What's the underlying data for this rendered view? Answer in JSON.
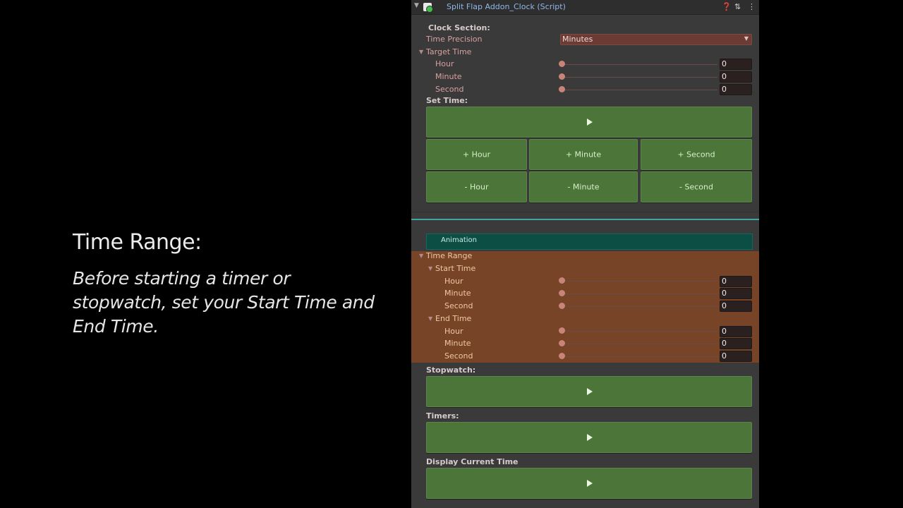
{
  "caption": {
    "title": "Time Range:",
    "body": "Before starting a timer or stopwatch, set your Start Time and End Time."
  },
  "inspector": {
    "title": "Split Flap Addon_Clock (Script)",
    "icons": [
      "help-icon",
      "preset-icon",
      "more-icon"
    ],
    "clock_section_label": "Clock Section:",
    "time_precision": {
      "label": "Time Precision",
      "value": "Minutes"
    },
    "target_time": {
      "label": "Target Time",
      "fields": [
        {
          "label": "Hour",
          "value": "0"
        },
        {
          "label": "Minute",
          "value": "0"
        },
        {
          "label": "Second",
          "value": "0"
        }
      ]
    },
    "set_time": {
      "label": "Set Time:",
      "buttons_plus": [
        "+ Hour",
        "+ Minute",
        "+ Second"
      ],
      "buttons_minus": [
        "- Hour",
        "- Minute",
        "- Second"
      ]
    },
    "animation_label": "Animation",
    "time_range": {
      "label": "Time Range",
      "start": {
        "label": "Start Time",
        "fields": [
          {
            "label": "Hour",
            "value": "0"
          },
          {
            "label": "Minute",
            "value": "0"
          },
          {
            "label": "Second",
            "value": "0"
          }
        ]
      },
      "end": {
        "label": "End Time",
        "fields": [
          {
            "label": "Hour",
            "value": "0"
          },
          {
            "label": "Minute",
            "value": "0"
          },
          {
            "label": "Second",
            "value": "0"
          }
        ]
      }
    },
    "stopwatch_label": "Stopwatch:",
    "timers_label": "Timers:",
    "display_current_label": "Display Current Time"
  },
  "colors": {
    "accent_teal": "#3fa7a0",
    "button_green": "#4c7539",
    "highlight_orange": "#7a4426"
  }
}
